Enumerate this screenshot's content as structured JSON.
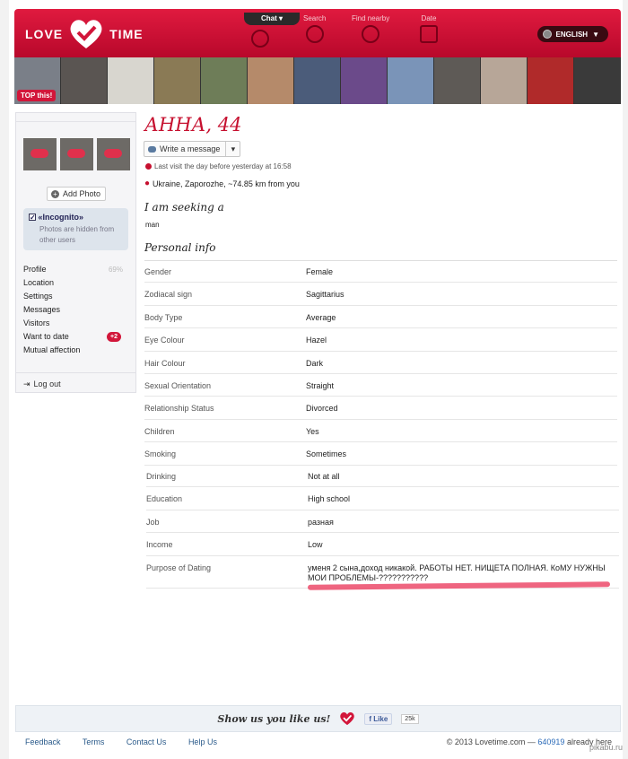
{
  "brand": {
    "left": "LOVE",
    "right": "TIME"
  },
  "nav": {
    "chat": "Chat",
    "search": "Search",
    "find_nearby": "Find nearby",
    "date": "Date",
    "language": "ENGLISH"
  },
  "strip": {
    "top_this": "TOP this!"
  },
  "sidebar": {
    "add_photo": "Add Photo",
    "incognito_title": "«Incognito»",
    "incognito_desc": "Photos are hidden from other users",
    "menu": [
      {
        "label": "Profile",
        "extra": "69%"
      },
      {
        "label": "Location",
        "extra": ""
      },
      {
        "label": "Settings",
        "extra": ""
      },
      {
        "label": "Messages",
        "extra": ""
      },
      {
        "label": "Visitors",
        "extra": ""
      },
      {
        "label": "Want to date",
        "extra": "+2"
      },
      {
        "label": "Mutual affection",
        "extra": ""
      }
    ],
    "logout": "Log out"
  },
  "profile": {
    "name": "АННА, 44",
    "write_message": "Write a message",
    "last_visit": "Last visit the day before yesterday at 16:58",
    "location": "Ukraine, Zaporozhe, ~74.85 km from you",
    "seeking_title": "I am seeking a",
    "seeking_value": "man",
    "personal_title": "Personal info"
  },
  "personal_info": [
    {
      "k": "Gender",
      "v": "Female"
    },
    {
      "k": "Zodiacal sign",
      "v": "Sagittarius"
    },
    {
      "k": "Body Type",
      "v": "Average"
    },
    {
      "k": "Eye Colour",
      "v": "Hazel"
    },
    {
      "k": "Hair Colour",
      "v": "Dark"
    },
    {
      "k": "Sexual Orientation",
      "v": "Straight"
    },
    {
      "k": "Relationship Status",
      "v": "Divorced"
    },
    {
      "k": "Children",
      "v": "Yes"
    },
    {
      "k": "Smoking",
      "v": "Sometimes"
    }
  ],
  "personal_info_2": [
    {
      "k": "Drinking",
      "v": "Not at all"
    },
    {
      "k": "Education",
      "v": "High school"
    },
    {
      "k": "Job",
      "v": "разная"
    },
    {
      "k": "Income",
      "v": "Low"
    },
    {
      "k": "Purpose of Dating",
      "v": "уменя 2 сына,доход никакой. РАБОТЫ НЕТ. НИЩЕТА ПОЛНАЯ. КоМУ НУЖНЫ МОИ ПРОБЛЕМЫ-???????????"
    }
  ],
  "footer": {
    "like_text": "Show us you like us!",
    "fb_like": "Like",
    "fb_count": "25k",
    "links": [
      "Feedback",
      "Terms",
      "Contact Us",
      "Help Us"
    ],
    "copyright": "© 2013 Lovetime.com —",
    "online_count": "640919",
    "online_suffix": "already here",
    "watermark": "pikabu.ru"
  },
  "colors": {
    "brand_red": "#c6102f",
    "header_red": "#e01a3f"
  }
}
